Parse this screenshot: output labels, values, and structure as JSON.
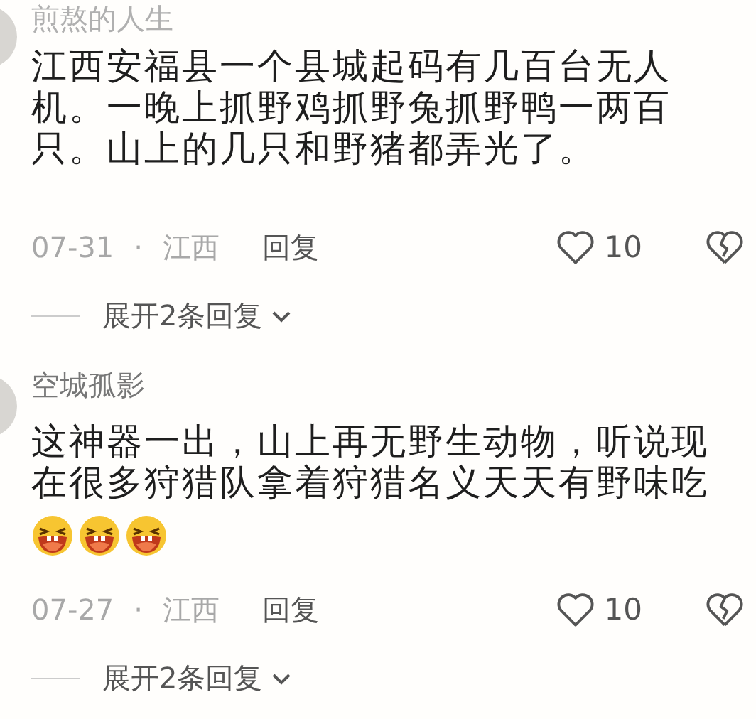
{
  "comments": [
    {
      "author": "煎熬的人生",
      "text": "江西安福县一个县城起码有几百台无人机。一晚上抓野鸡抓野兔抓野鸭一两百只。山上的几只和野猪都弄光了。",
      "date": "07-31",
      "separator": "·",
      "location": "江西",
      "reply": "回复",
      "likes": "10",
      "expand": "展开2条回复"
    },
    {
      "author": "空城孤影",
      "text": "这神器一出，山上再无野生动物，听说现在很多狩猎队拿着狩猎名义天天有野味吃",
      "emojis": [
        {
          "kind": "laugh"
        },
        {
          "kind": "laugh"
        },
        {
          "kind": "laugh"
        }
      ],
      "date": "07-27",
      "separator": "·",
      "location": "江西",
      "reply": "回复",
      "likes": "10",
      "expand": "展开2条回复"
    }
  ]
}
